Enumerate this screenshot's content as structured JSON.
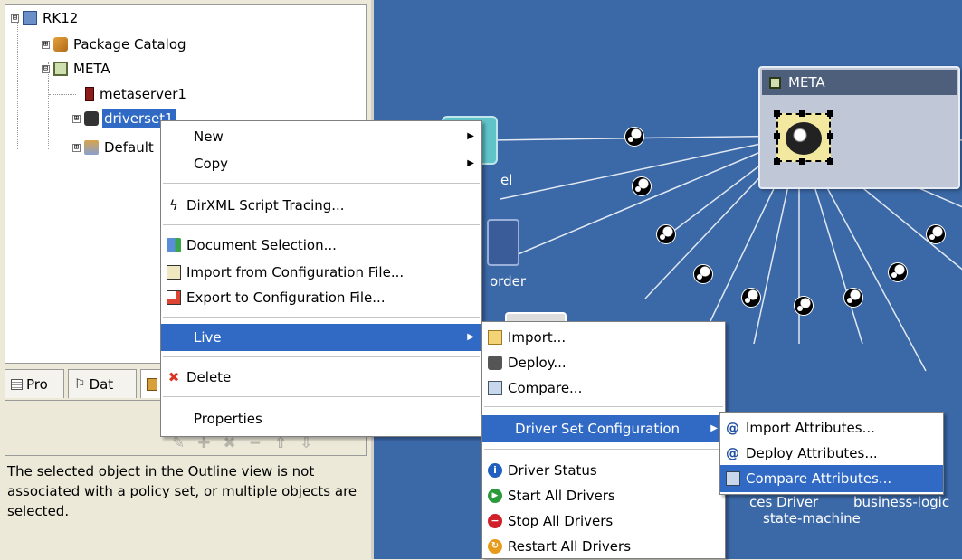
{
  "tree": {
    "items": [
      {
        "label": "RK12",
        "expander": "⊟"
      },
      {
        "label": "Package Catalog",
        "expander": "⊞"
      },
      {
        "label": "META",
        "expander": "⊟"
      },
      {
        "label": "metaserver1",
        "expander": ""
      },
      {
        "label": "driverset1",
        "expander": "⊞"
      },
      {
        "label": "Default",
        "expander": "⊞"
      }
    ]
  },
  "tabs": [
    {
      "label": "Pro"
    },
    {
      "label": "Dat"
    },
    {
      "label": ""
    }
  ],
  "panel": {
    "message": "The selected object in the Outline view is not associated with a policy set, or multiple objects are selected."
  },
  "canvas": {
    "meta_title": "META",
    "labels": [
      "el",
      "order",
      "ces Driver",
      "business-logic",
      "state-machine"
    ]
  },
  "context_menu": {
    "items": [
      {
        "label": "New",
        "submenu": true
      },
      {
        "label": "Copy",
        "submenu": true
      },
      {
        "label": "DirXML Script Tracing..."
      },
      {
        "label": "Document Selection..."
      },
      {
        "label": "Import from Configuration File..."
      },
      {
        "label": "Export to Configuration File..."
      },
      {
        "label": "Live",
        "submenu": true,
        "highlighted": true
      },
      {
        "label": "Delete"
      },
      {
        "label": "Properties"
      }
    ]
  },
  "live_menu": {
    "items": [
      {
        "label": "Import..."
      },
      {
        "label": "Deploy..."
      },
      {
        "label": "Compare..."
      },
      {
        "label": "Driver Set Configuration",
        "submenu": true,
        "highlighted": true
      },
      {
        "label": "Driver Status"
      },
      {
        "label": "Start All Drivers"
      },
      {
        "label": "Stop All Drivers"
      },
      {
        "label": "Restart All Drivers"
      }
    ]
  },
  "dsc_menu": {
    "items": [
      {
        "label": "Import Attributes..."
      },
      {
        "label": "Deploy Attributes..."
      },
      {
        "label": "Compare Attributes...",
        "highlighted": true
      }
    ]
  },
  "colors": {
    "canvas_bg": "#3b69a8",
    "highlight": "#316ac5",
    "panel_bg": "#ece9d8"
  }
}
